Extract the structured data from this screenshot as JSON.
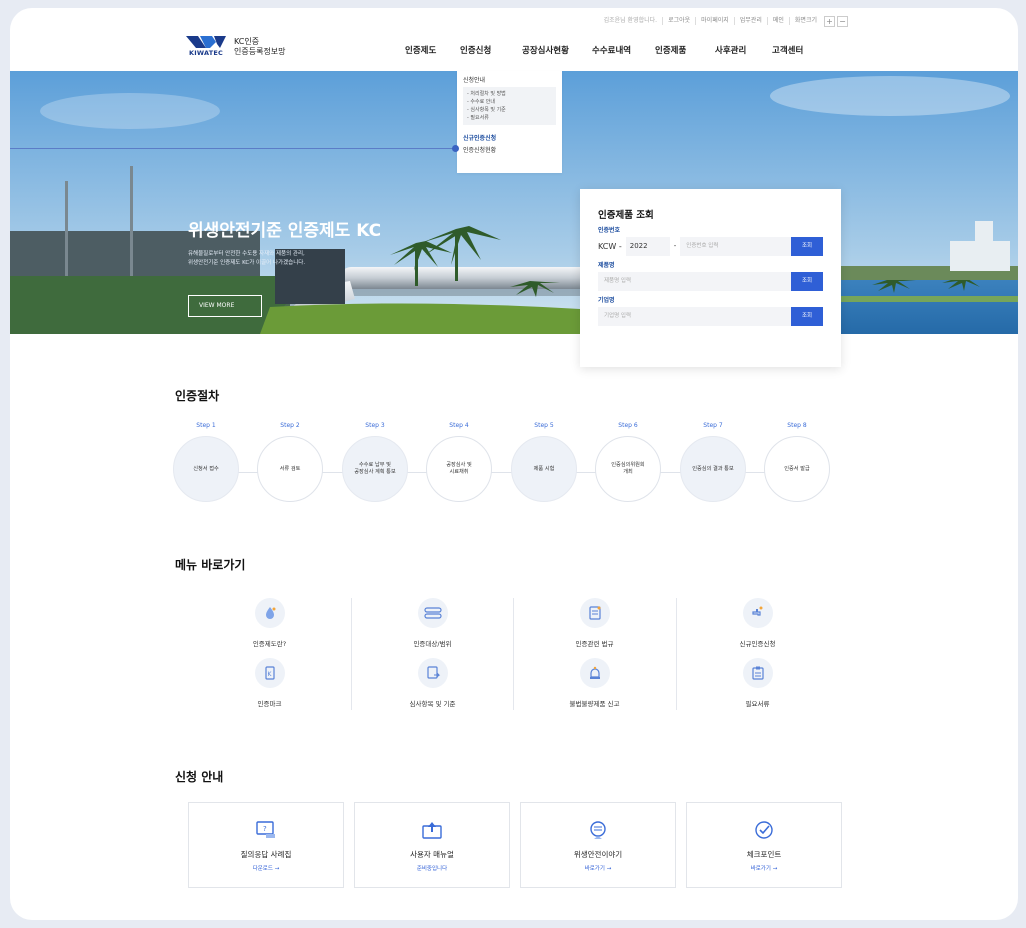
{
  "utility": {
    "welcome": "김조윤님 환영합니다.",
    "logout": "로그아웃",
    "mypage": "마이페이지",
    "admin": "업무관리",
    "home": "메인",
    "fontsize": "화면크기",
    "plus": "+",
    "minus": "−"
  },
  "logo": {
    "en": "KIWATEC",
    "line1": "KC인증",
    "line2": "인증등록정보망"
  },
  "nav": [
    "인증제도",
    "인증신청",
    "공장심사현황",
    "수수료내역",
    "인증제품",
    "사후관리",
    "고객센터"
  ],
  "dropdown": {
    "title": "신청안내",
    "subs": [
      "- 처리절차 및 방법",
      "- 수수료 안내",
      "- 심사항목 및 기준",
      "- 필요서류"
    ],
    "highlight": "신규인증신청",
    "item2": "인증신청현황"
  },
  "hero": {
    "title": "위생안전기준 인증제도 KC",
    "desc1": "유해물질로부터 안전한 수도용 자재와 제품의 관리,",
    "desc2": "위생안전기준 인증제도 KC가 이끌어 나가겠습니다.",
    "button": "VIEW MORE"
  },
  "search": {
    "title": "인증제품 조회",
    "cert_label": "인증번호",
    "prefix": "KCW -",
    "year": "2022",
    "dash": "-",
    "cert_placeholder": "인증번호 입력",
    "product_label": "제품명",
    "product_placeholder": "제품명 입력",
    "company_label": "기업명",
    "company_placeholder": "기업명 입력",
    "button": "조회"
  },
  "procedure": {
    "title": "인증절차",
    "steps": [
      {
        "label": "Step 1",
        "text1": "신청서 접수",
        "text2": ""
      },
      {
        "label": "Step 2",
        "text1": "서류 검토",
        "text2": ""
      },
      {
        "label": "Step 3",
        "text1": "수수료 납부 및",
        "text2": "공장심사 계획 통보"
      },
      {
        "label": "Step 4",
        "text1": "공장심사 및",
        "text2": "시료채취"
      },
      {
        "label": "Step 5",
        "text1": "제품 시험",
        "text2": ""
      },
      {
        "label": "Step 6",
        "text1": "인증심의위원회",
        "text2": "개최"
      },
      {
        "label": "Step 7",
        "text1": "인증심의 결과 통보",
        "text2": ""
      },
      {
        "label": "Step 8",
        "text1": "인증서 발급",
        "text2": ""
      }
    ]
  },
  "shortcuts": {
    "title": "메뉴 바로가기",
    "items": [
      "인증제도란?",
      "인증대상/범위",
      "인증관련 법규",
      "신규인증신청",
      "인증마크",
      "심사항목 및 기준",
      "불법불량제품 신고",
      "필요서류"
    ]
  },
  "guide": {
    "title": "신청 안내",
    "items": [
      {
        "title": "질의응답 사례집",
        "link": "다운로드 →"
      },
      {
        "title": "사용자 매뉴얼",
        "link": "준비중입니다"
      },
      {
        "title": "위생안전이야기",
        "link": "바로가기 →"
      },
      {
        "title": "체크포인트",
        "link": "바로가기 →"
      }
    ]
  },
  "colors": {
    "accent": "#2f5fd6",
    "brand_navy": "#1a3a8a",
    "step_label": "#3a6cd8"
  }
}
